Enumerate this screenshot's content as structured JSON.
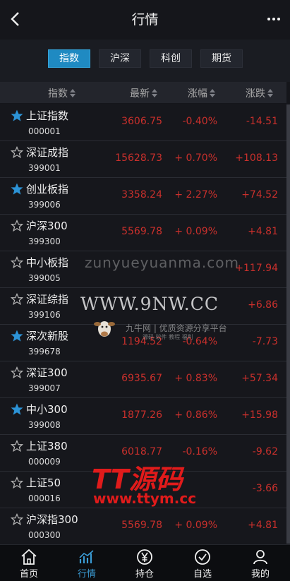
{
  "header": {
    "title": "行情"
  },
  "tabs": [
    "指数",
    "沪深",
    "科创",
    "期货"
  ],
  "columns": {
    "name": "指数",
    "price": "最新",
    "pct": "涨幅",
    "chg": "涨跌"
  },
  "rows": [
    {
      "name": "上证指数",
      "code": "000001",
      "price": "3606.75",
      "pct": "-0.40%",
      "chg": "-14.51",
      "starred": true
    },
    {
      "name": "深证成指",
      "code": "399001",
      "price": "15628.73",
      "pct": "+ 0.70%",
      "chg": "+108.13",
      "starred": false
    },
    {
      "name": "创业板指",
      "code": "399006",
      "price": "3358.24",
      "pct": "+ 2.27%",
      "chg": "+74.52",
      "starred": true
    },
    {
      "name": "沪深300",
      "code": "399300",
      "price": "5569.78",
      "pct": "+ 0.09%",
      "chg": "+4.81",
      "starred": false
    },
    {
      "name": "中小板指",
      "code": "399005",
      "price": "",
      "pct": "",
      "chg": "+117.94",
      "starred": false
    },
    {
      "name": "深证综指",
      "code": "399106",
      "price": "",
      "pct": "",
      "chg": "+6.86",
      "starred": false
    },
    {
      "name": "深次新股",
      "code": "399678",
      "price": "1194.52",
      "pct": "-0.64%",
      "chg": "-7.73",
      "starred": true
    },
    {
      "name": "深证300",
      "code": "399007",
      "price": "6935.67",
      "pct": "+ 0.83%",
      "chg": "+57.34",
      "starred": false
    },
    {
      "name": "中小300",
      "code": "399008",
      "price": "1877.26",
      "pct": "+ 0.86%",
      "chg": "+15.98",
      "starred": true
    },
    {
      "name": "上证380",
      "code": "000009",
      "price": "6018.77",
      "pct": "-0.16%",
      "chg": "-9.62",
      "starred": false
    },
    {
      "name": "上证50",
      "code": "000016",
      "price": "",
      "pct": "",
      "chg": "-3.66",
      "starred": false
    },
    {
      "name": "沪深指300",
      "code": "000300",
      "price": "5569.78",
      "pct": "+ 0.09%",
      "chg": "+4.81",
      "starred": false
    }
  ],
  "watermarks": {
    "url1": "zunyueyuanma.com",
    "site": "WWW.9NW.CC",
    "brand": "九牛网 | 优质资源分享平台",
    "tags": "源码  软件  教程  福利",
    "logo": "TT源码",
    "url2": "www.ttym.cc"
  },
  "nav": [
    {
      "label": "首页",
      "icon": "home-icon"
    },
    {
      "label": "行情",
      "icon": "chart-icon"
    },
    {
      "label": "持仓",
      "icon": "yen-icon"
    },
    {
      "label": "自选",
      "icon": "check-circle-icon"
    },
    {
      "label": "我的",
      "icon": "user-icon"
    }
  ],
  "colors": {
    "accent": "#1f8ac2",
    "price": "#c9302c",
    "star": "#2c93d6"
  }
}
